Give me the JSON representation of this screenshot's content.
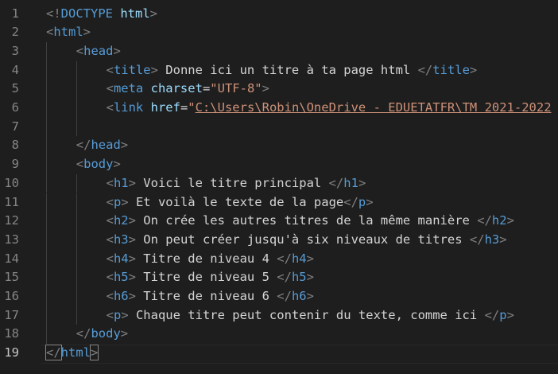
{
  "editor": {
    "active_line": 19,
    "lines": [
      {
        "num": "1",
        "indent": 0,
        "tokens": [
          {
            "k": "t-punct",
            "v": "<!"
          },
          {
            "k": "t-tag",
            "v": "DOCTYPE"
          },
          {
            "k": "t-text",
            "v": " "
          },
          {
            "k": "t-attr",
            "v": "html"
          },
          {
            "k": "t-punct",
            "v": ">"
          }
        ]
      },
      {
        "num": "2",
        "indent": 0,
        "tokens": [
          {
            "k": "t-punct",
            "v": "<"
          },
          {
            "k": "t-tag",
            "v": "html"
          },
          {
            "k": "t-punct",
            "v": ">"
          }
        ]
      },
      {
        "num": "3",
        "indent": 1,
        "tokens": [
          {
            "k": "t-punct",
            "v": "<"
          },
          {
            "k": "t-tag",
            "v": "head"
          },
          {
            "k": "t-punct",
            "v": ">"
          }
        ]
      },
      {
        "num": "4",
        "indent": 2,
        "tokens": [
          {
            "k": "t-punct",
            "v": "<"
          },
          {
            "k": "t-tag",
            "v": "title"
          },
          {
            "k": "t-punct",
            "v": ">"
          },
          {
            "k": "t-text",
            "v": " Donne ici un titre à ta page html "
          },
          {
            "k": "t-punct",
            "v": "</"
          },
          {
            "k": "t-tag",
            "v": "title"
          },
          {
            "k": "t-punct",
            "v": ">"
          }
        ]
      },
      {
        "num": "5",
        "indent": 2,
        "tokens": [
          {
            "k": "t-punct",
            "v": "<"
          },
          {
            "k": "t-tag",
            "v": "meta"
          },
          {
            "k": "t-text",
            "v": " "
          },
          {
            "k": "t-attr",
            "v": "charset"
          },
          {
            "k": "t-eq",
            "v": "="
          },
          {
            "k": "t-str",
            "v": "\"UTF-8\""
          },
          {
            "k": "t-punct",
            "v": ">"
          }
        ]
      },
      {
        "num": "6",
        "indent": 2,
        "tokens": [
          {
            "k": "t-punct",
            "v": "<"
          },
          {
            "k": "t-tag",
            "v": "link"
          },
          {
            "k": "t-text",
            "v": " "
          },
          {
            "k": "t-attr",
            "v": "href"
          },
          {
            "k": "t-eq",
            "v": "="
          },
          {
            "k": "t-str",
            "v": "\""
          },
          {
            "k": "t-link",
            "v": "C:\\Users\\Robin\\OneDrive - EDUETATFR\\TM 2021-2022"
          }
        ]
      },
      {
        "num": "7",
        "indent": 2,
        "tokens": []
      },
      {
        "num": "8",
        "indent": 1,
        "tokens": [
          {
            "k": "t-punct",
            "v": "</"
          },
          {
            "k": "t-tag",
            "v": "head"
          },
          {
            "k": "t-punct",
            "v": ">"
          }
        ]
      },
      {
        "num": "9",
        "indent": 1,
        "tokens": [
          {
            "k": "t-punct",
            "v": "<"
          },
          {
            "k": "t-tag",
            "v": "body"
          },
          {
            "k": "t-punct",
            "v": ">"
          }
        ]
      },
      {
        "num": "10",
        "indent": 2,
        "tokens": [
          {
            "k": "t-punct",
            "v": "<"
          },
          {
            "k": "t-tag",
            "v": "h1"
          },
          {
            "k": "t-punct",
            "v": ">"
          },
          {
            "k": "t-text",
            "v": " Voici le titre principal "
          },
          {
            "k": "t-punct",
            "v": "</"
          },
          {
            "k": "t-tag",
            "v": "h1"
          },
          {
            "k": "t-punct",
            "v": ">"
          }
        ]
      },
      {
        "num": "11",
        "indent": 2,
        "tokens": [
          {
            "k": "t-punct",
            "v": "<"
          },
          {
            "k": "t-tag",
            "v": "p"
          },
          {
            "k": "t-punct",
            "v": ">"
          },
          {
            "k": "t-text",
            "v": " Et voilà le texte de la page"
          },
          {
            "k": "t-punct",
            "v": "</"
          },
          {
            "k": "t-tag",
            "v": "p"
          },
          {
            "k": "t-punct",
            "v": ">"
          }
        ]
      },
      {
        "num": "12",
        "indent": 2,
        "tokens": [
          {
            "k": "t-punct",
            "v": "<"
          },
          {
            "k": "t-tag",
            "v": "h2"
          },
          {
            "k": "t-punct",
            "v": ">"
          },
          {
            "k": "t-text",
            "v": " On crée les autres titres de la même manière "
          },
          {
            "k": "t-punct",
            "v": "</"
          },
          {
            "k": "t-tag",
            "v": "h2"
          },
          {
            "k": "t-punct",
            "v": ">"
          }
        ]
      },
      {
        "num": "13",
        "indent": 2,
        "tokens": [
          {
            "k": "t-punct",
            "v": "<"
          },
          {
            "k": "t-tag",
            "v": "h3"
          },
          {
            "k": "t-punct",
            "v": ">"
          },
          {
            "k": "t-text",
            "v": " On peut créer jusqu'à six niveaux de titres "
          },
          {
            "k": "t-punct",
            "v": "</"
          },
          {
            "k": "t-tag",
            "v": "h3"
          },
          {
            "k": "t-punct",
            "v": ">"
          }
        ]
      },
      {
        "num": "14",
        "indent": 2,
        "tokens": [
          {
            "k": "t-punct",
            "v": "<"
          },
          {
            "k": "t-tag",
            "v": "h4"
          },
          {
            "k": "t-punct",
            "v": ">"
          },
          {
            "k": "t-text",
            "v": " Titre de niveau 4 "
          },
          {
            "k": "t-punct",
            "v": "</"
          },
          {
            "k": "t-tag",
            "v": "h4"
          },
          {
            "k": "t-punct",
            "v": ">"
          }
        ]
      },
      {
        "num": "15",
        "indent": 2,
        "tokens": [
          {
            "k": "t-punct",
            "v": "<"
          },
          {
            "k": "t-tag",
            "v": "h5"
          },
          {
            "k": "t-punct",
            "v": ">"
          },
          {
            "k": "t-text",
            "v": " Titre de niveau 5 "
          },
          {
            "k": "t-punct",
            "v": "</"
          },
          {
            "k": "t-tag",
            "v": "h5"
          },
          {
            "k": "t-punct",
            "v": ">"
          }
        ]
      },
      {
        "num": "16",
        "indent": 2,
        "tokens": [
          {
            "k": "t-punct",
            "v": "<"
          },
          {
            "k": "t-tag",
            "v": "h6"
          },
          {
            "k": "t-punct",
            "v": ">"
          },
          {
            "k": "t-text",
            "v": " Titre de niveau 6 "
          },
          {
            "k": "t-punct",
            "v": "</"
          },
          {
            "k": "t-tag",
            "v": "h6"
          },
          {
            "k": "t-punct",
            "v": ">"
          }
        ]
      },
      {
        "num": "17",
        "indent": 2,
        "tokens": [
          {
            "k": "t-punct",
            "v": "<"
          },
          {
            "k": "t-tag",
            "v": "p"
          },
          {
            "k": "t-punct",
            "v": ">"
          },
          {
            "k": "t-text",
            "v": " Chaque titre peut contenir du texte, comme ici "
          },
          {
            "k": "t-punct",
            "v": "</"
          },
          {
            "k": "t-tag",
            "v": "p"
          },
          {
            "k": "t-punct",
            "v": ">"
          }
        ]
      },
      {
        "num": "18",
        "indent": 1,
        "tokens": [
          {
            "k": "t-punct",
            "v": "</"
          },
          {
            "k": "t-tag",
            "v": "body"
          },
          {
            "k": "t-punct",
            "v": ">"
          }
        ]
      },
      {
        "num": "19",
        "indent": 0,
        "tokens": [
          {
            "k": "t-punct",
            "v": "</"
          },
          {
            "k": "t-tag",
            "v": "html"
          },
          {
            "k": "t-punct",
            "v": ">"
          }
        ]
      }
    ]
  },
  "colors": {
    "background": "#1e1e1e",
    "line_number": "#858585",
    "line_number_active": "#c6c6c6",
    "tag": "#569cd6",
    "punctuation": "#808080",
    "attribute": "#9cdcfe",
    "string": "#ce9178",
    "text": "#d4d4d4"
  }
}
